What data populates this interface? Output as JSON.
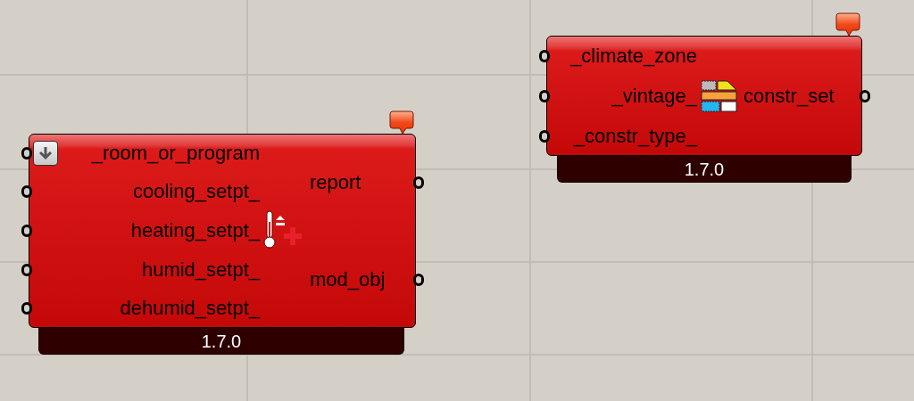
{
  "components": [
    {
      "kind": "thermostat",
      "menu_button": true,
      "inputs": [
        {
          "label": "_room_or_program"
        },
        {
          "label": "cooling_setpt_"
        },
        {
          "label": "heating_setpt_"
        },
        {
          "label": "humid_setpt_"
        },
        {
          "label": "dehumid_setpt_"
        }
      ],
      "outputs": [
        {
          "label": "report"
        },
        {
          "label": "mod_obj"
        }
      ],
      "version": "1.7.0"
    },
    {
      "kind": "construction_set",
      "menu_button": false,
      "inputs": [
        {
          "label": "_climate_zone"
        },
        {
          "label": "_vintage_"
        },
        {
          "label": "_constr_type_"
        }
      ],
      "outputs": [
        {
          "label": "constr_set"
        }
      ],
      "version": "1.7.0"
    }
  ]
}
